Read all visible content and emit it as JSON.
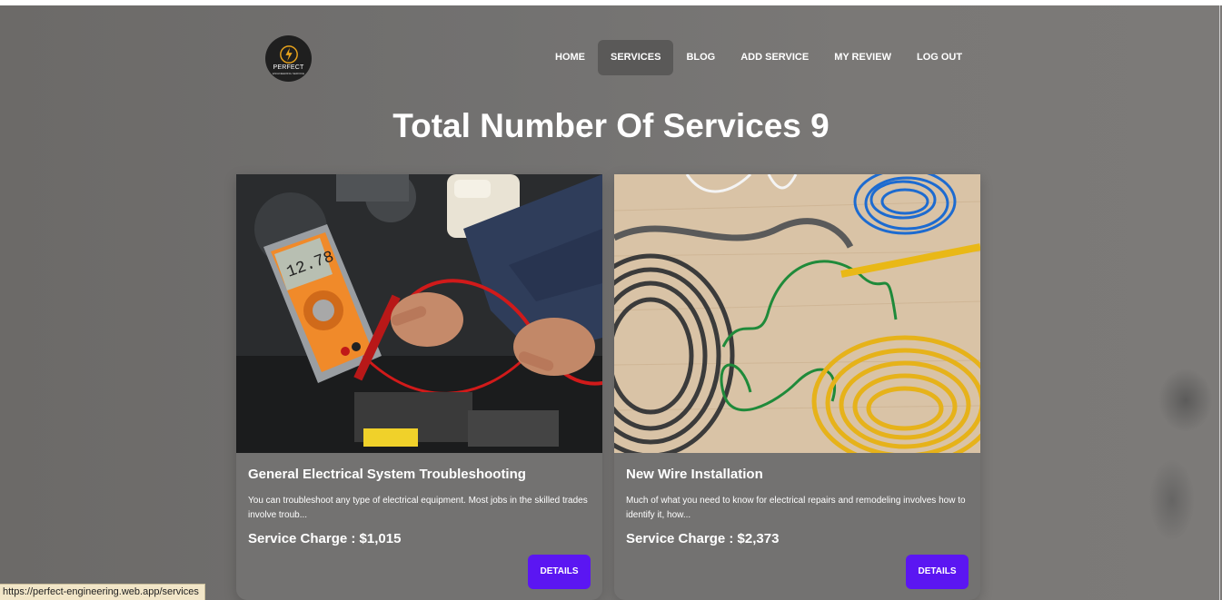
{
  "logo": {
    "text": "PERFECT",
    "sub": "ENGINEERING SERVICE"
  },
  "nav": {
    "items": [
      {
        "label": "HOME"
      },
      {
        "label": "SERVICES"
      },
      {
        "label": "BLOG"
      },
      {
        "label": "ADD SERVICE"
      },
      {
        "label": "MY REVIEW"
      },
      {
        "label": "LOG OUT"
      }
    ],
    "active": "SERVICES"
  },
  "page": {
    "title": "Total Number Of Services 9"
  },
  "services": [
    {
      "title": "General Electrical System Troubleshooting",
      "description": "You can troubleshoot any type of electrical equipment. Most jobs in the skilled trades involve troub...",
      "price": "Service Charge : $1,015",
      "button": "DETAILS"
    },
    {
      "title": "New Wire Installation",
      "description": "Much of what you need to know for electrical repairs and remodeling involves how to identify it, how...",
      "price": "Service Charge : $2,373",
      "button": "DETAILS"
    }
  ],
  "status_bar": {
    "url": "https://perfect-engineering.web.app/services"
  },
  "colors": {
    "accent": "#5b16f2",
    "background": "#737271",
    "text": "#ffffff"
  }
}
